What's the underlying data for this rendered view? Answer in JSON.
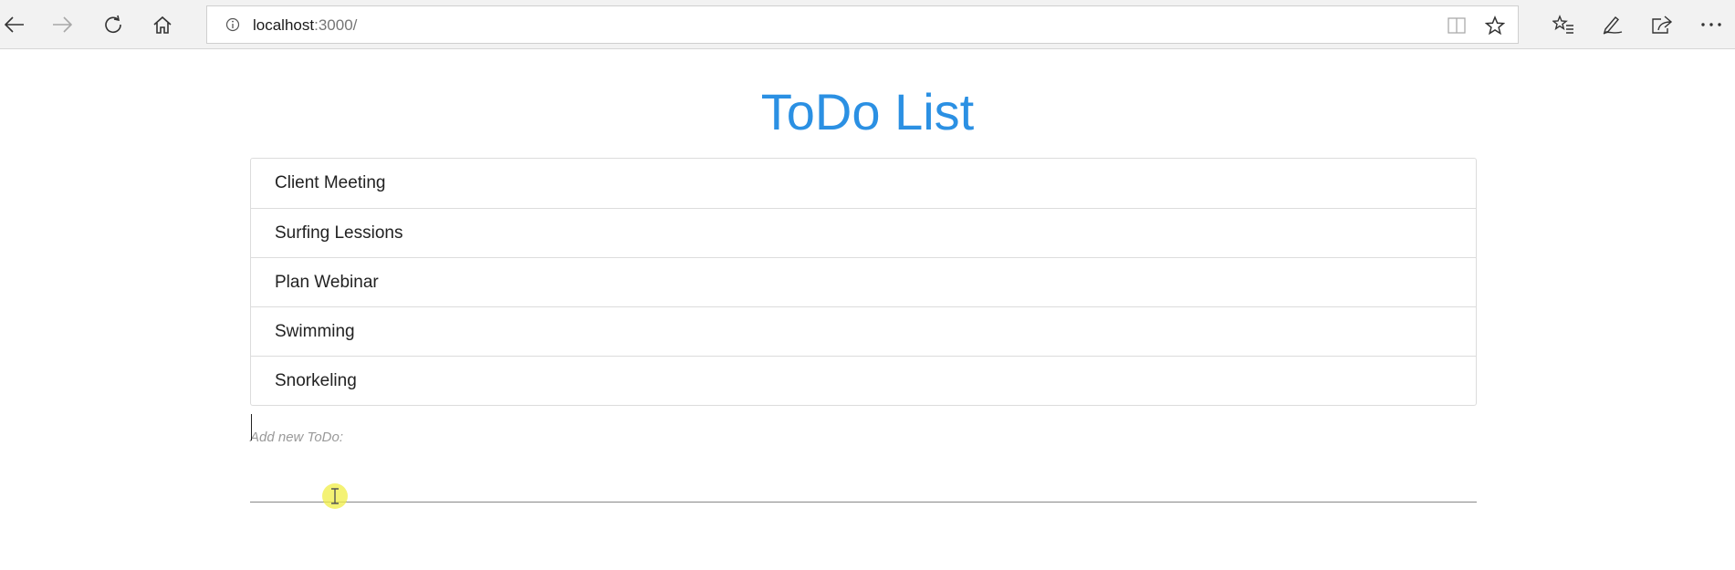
{
  "browser": {
    "icons": {
      "back": "back-arrow-icon",
      "forward": "forward-arrow-icon",
      "refresh": "refresh-icon",
      "home": "home-icon",
      "info": "info-icon",
      "reading_view": "reading-view-icon",
      "favorite": "star-icon",
      "favorites_hub": "favorites-list-icon",
      "notes": "pen-icon",
      "share": "share-icon",
      "more": "more-icon"
    },
    "address": {
      "host": "localhost",
      "port_path": ":3000/"
    }
  },
  "page": {
    "title": "ToDo List",
    "todos": [
      "Client Meeting",
      "Surfing Lessions",
      "Plan Webinar",
      "Swimming",
      "Snorkeling"
    ],
    "new_todo": {
      "label": "Add new ToDo:",
      "value": ""
    }
  },
  "colors": {
    "title": "#2b90e3",
    "chrome_bg": "#f2f2f2",
    "border": "#dcdcdc",
    "cursor_highlight": "#f0ee46"
  }
}
